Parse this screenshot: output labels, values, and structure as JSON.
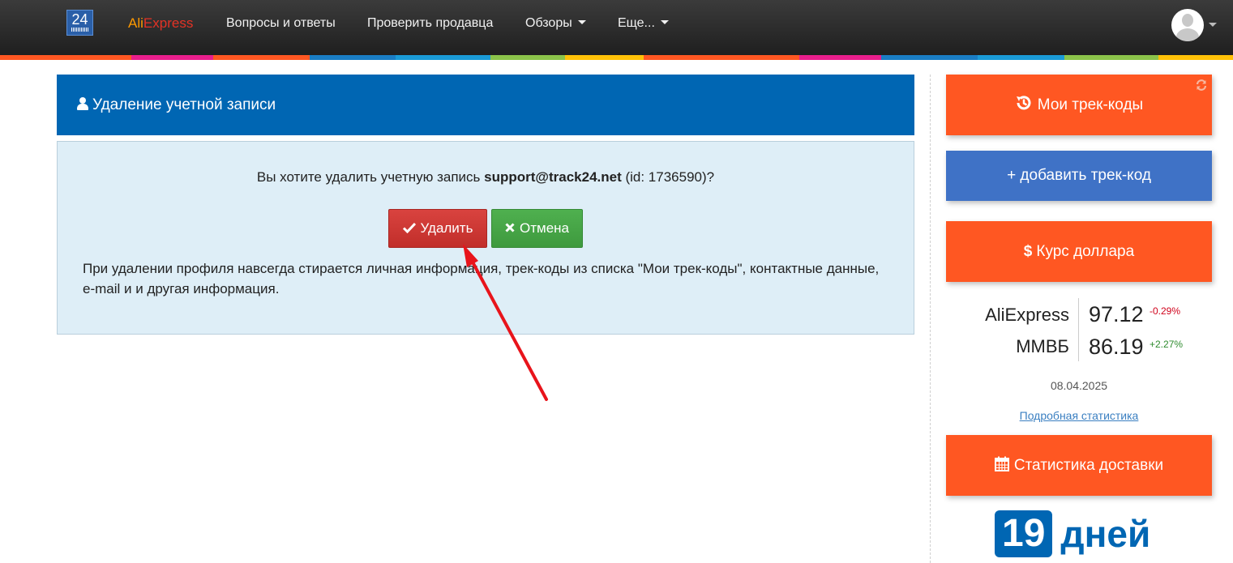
{
  "navbar": {
    "logo_text": "24",
    "brand_part1": "Ali",
    "brand_part2": "Express",
    "items": [
      {
        "label": "Вопросы и ответы"
      },
      {
        "label": "Проверить продавца"
      },
      {
        "label": "Обзоры"
      },
      {
        "label": "Еще..."
      }
    ]
  },
  "stripe_colors": [
    "#ff5722",
    "#e91e8c",
    "#ff5722",
    "#1a7dc4",
    "#1a9ad6",
    "#8bc34a",
    "#ffc107",
    "#ff5722",
    "#e91e8c",
    "#1a7dc4",
    "#1a9ad6",
    "#8bc34a",
    "#ffc107"
  ],
  "main": {
    "title": "Удаление учетной записи",
    "question_prefix": "Вы хотите удалить учетную запись ",
    "email": "support@track24.net",
    "question_suffix": " (id: 1736590)?",
    "delete_label": "Удалить",
    "cancel_label": "Отмена",
    "note": "При удалении профиля навсегда стирается личная информация, трек-коды из списка \"Мои трек-коды\", контактные данные, e-mail и и другая информация."
  },
  "sidebar": {
    "my_tracks": "Мои трек-коды",
    "add_track": "+ добавить трек-код",
    "dollar_rate": "Курс доллара",
    "rates": [
      {
        "name": "AliExpress",
        "value": "97.12",
        "change": "-0.29%",
        "color": "#d0021b"
      },
      {
        "name": "ММВБ",
        "value": "86.19",
        "change": "+2.27%",
        "color": "#2e8b2e"
      }
    ],
    "date": "08.04.2025",
    "stats_link": "Подробная статистика",
    "delivery_stats": "Статистика доставки",
    "days_number": "19",
    "days_word": "дней"
  },
  "colors": {
    "navbar": "#2b2b2b",
    "panel_header": "#0066b3",
    "orange": "#ff5722",
    "blue_button": "#3f72c6",
    "delete": "#c9302c",
    "cancel": "#449d44",
    "arrow": "#e8141b"
  }
}
